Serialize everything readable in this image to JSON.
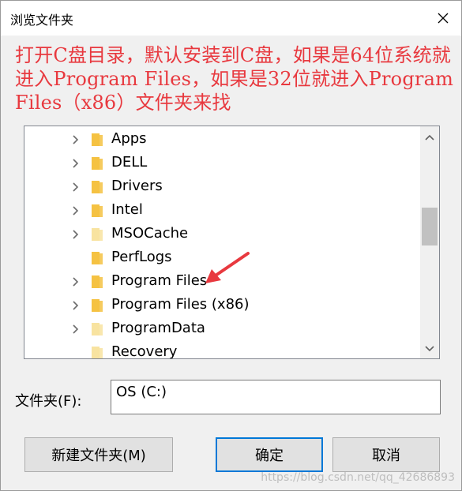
{
  "dialog": {
    "title": "浏览文件夹",
    "annotation": "打开C盘目录，默认安装到C盘，如果是64位系统就进入Program Files，如果是32位就进入Program Files（x86）文件夹来找",
    "folder_label": "文件夹(F):",
    "folder_value": "OS (C:)",
    "buttons": {
      "new_folder": "新建文件夹(M)",
      "ok": "确定",
      "cancel": "取消"
    },
    "watermark": "https://blog.csdn.net/qq_42686893"
  },
  "tree": {
    "items": [
      {
        "label": "Apps",
        "expandable": true,
        "folder": "yellow"
      },
      {
        "label": "DELL",
        "expandable": true,
        "folder": "yellow"
      },
      {
        "label": "Drivers",
        "expandable": true,
        "folder": "yellow"
      },
      {
        "label": "Intel",
        "expandable": true,
        "folder": "yellow"
      },
      {
        "label": "MSOCache",
        "expandable": true,
        "folder": "pale"
      },
      {
        "label": "PerfLogs",
        "expandable": false,
        "folder": "yellow"
      },
      {
        "label": "Program Files",
        "expandable": true,
        "folder": "yellow"
      },
      {
        "label": "Program Files (x86)",
        "expandable": true,
        "folder": "yellow"
      },
      {
        "label": "ProgramData",
        "expandable": true,
        "folder": "pale"
      },
      {
        "label": "Recovery",
        "expandable": false,
        "folder": "pale"
      }
    ]
  },
  "colors": {
    "annotation": "#e8393f",
    "folder_yellow": "#f5c242",
    "folder_pale": "#f8e3a0",
    "primary_border": "#0078d7"
  }
}
